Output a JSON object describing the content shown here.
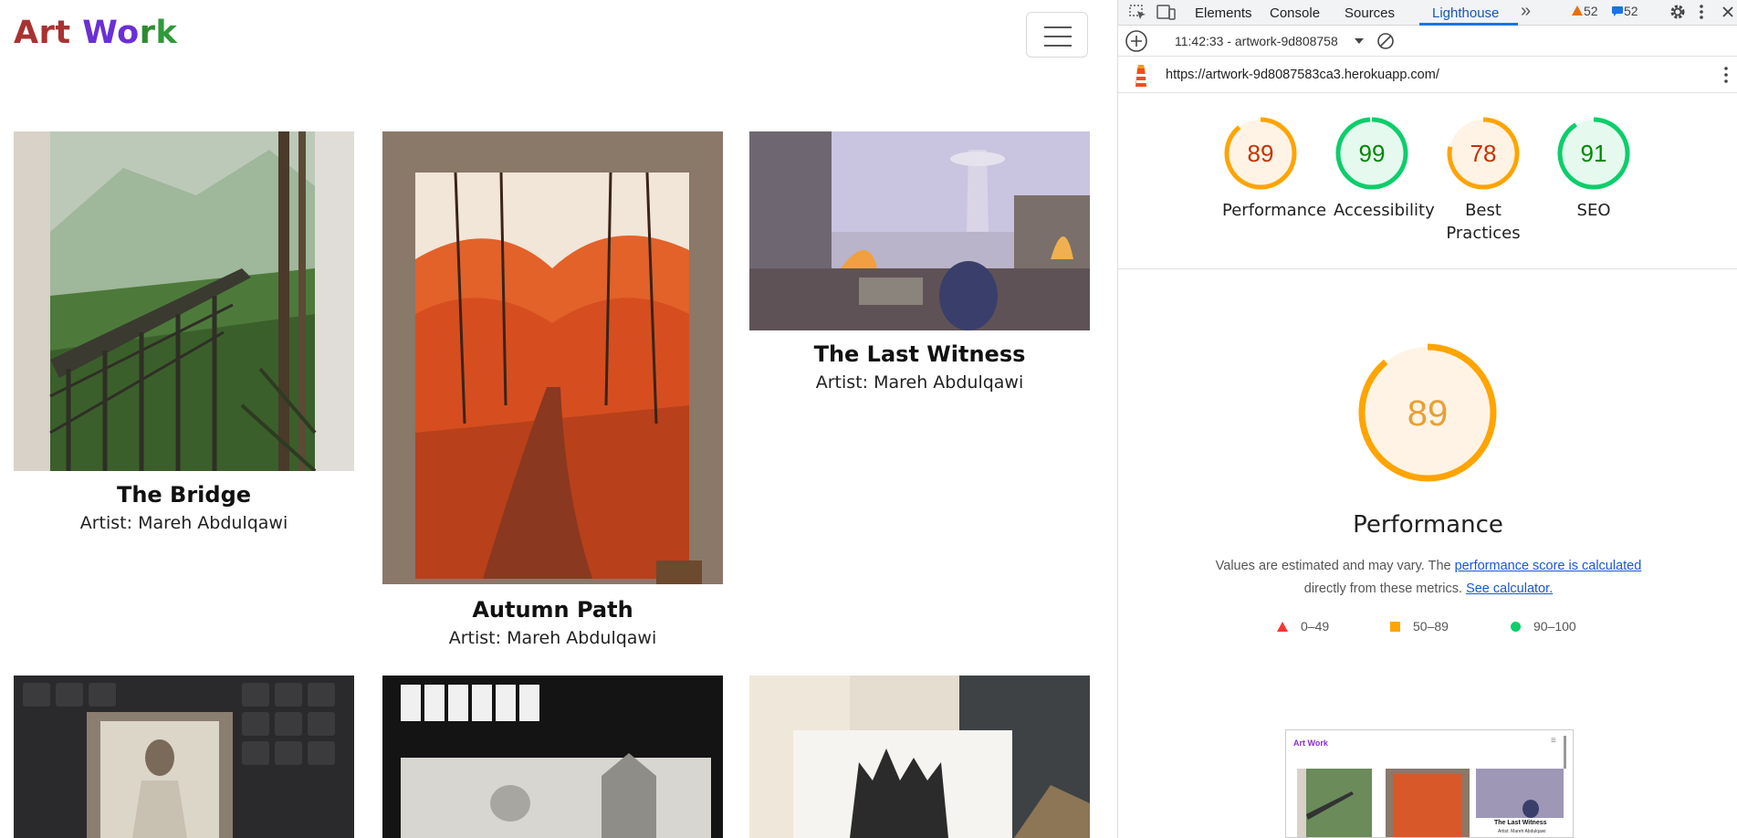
{
  "site": {
    "logo": [
      "Art",
      " ",
      "Wo",
      "r",
      "k"
    ],
    "menu_button": "menu-toggle",
    "artworks": [
      {
        "title": "The Bridge",
        "artist": "Artist: Mareh Abdulqawi"
      },
      {
        "title": "Autumn Path",
        "artist": "Artist: Mareh Abdulqawi"
      },
      {
        "title": "The Last Witness",
        "artist": "Artist: Mareh Abdulqawi"
      }
    ]
  },
  "devtools": {
    "tabs": [
      "Elements",
      "Console",
      "Sources",
      "Lighthouse"
    ],
    "active_tab": "Lighthouse",
    "more_tabs": "»",
    "warnings": "52",
    "messages": "52",
    "report_selector": "11:42:33 - artwork-9d808758",
    "url": "https://artwork-9d8087583ca3.herokuapp.com/",
    "scores": [
      {
        "label": "Performance",
        "value": "89",
        "color": "#ffa400"
      },
      {
        "label": "Accessibility",
        "value": "99",
        "color": "#0cce6b"
      },
      {
        "label": "Best Practices",
        "value": "78",
        "color": "#ffa400"
      },
      {
        "label": "SEO",
        "value": "91",
        "color": "#0cce6b"
      }
    ],
    "main_score": "89",
    "main_title": "Performance",
    "note_prefix": "Values are estimated and may vary. The ",
    "note_link1": "performance score is calculated",
    "note_mid": " directly from these metrics. ",
    "note_link2": "See calculator.",
    "legend": [
      "0–49",
      "50–89",
      "90–100"
    ],
    "thumb_logo": "Art Work",
    "thumb_caption": "The Last Witness",
    "thumb_artist": "Artist: Mareh Abdulqawi",
    "colors": {
      "fail": "#ff3333",
      "average": "#ffa400",
      "pass": "#0cce6b",
      "average_text": "#c33300",
      "pass_text": "#008800"
    }
  }
}
